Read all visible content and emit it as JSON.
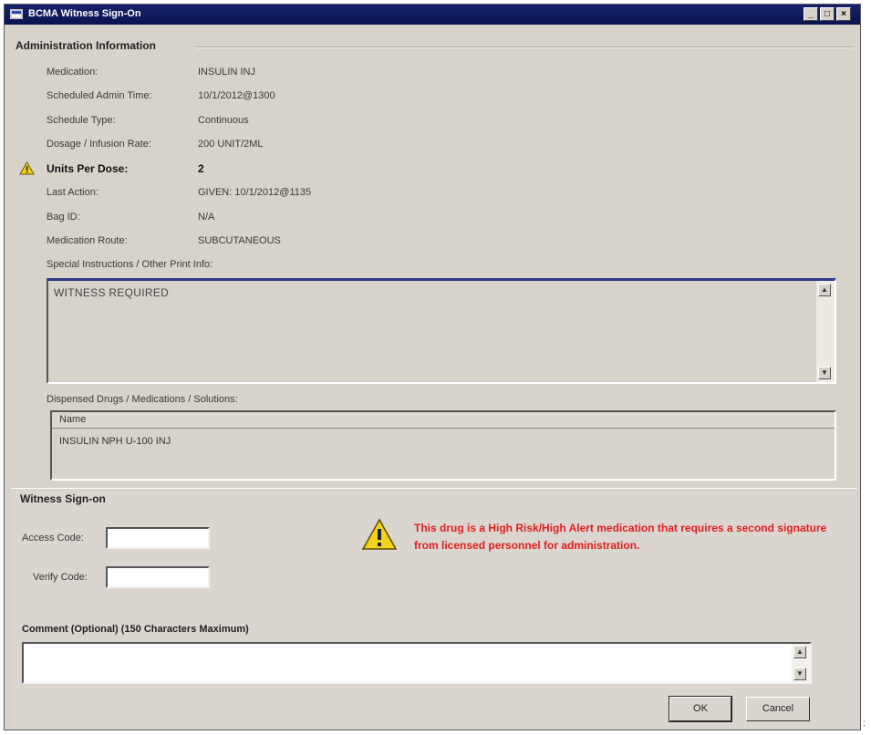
{
  "window": {
    "title": "BCMA Witness Sign-On",
    "controls": {
      "minimize": "_",
      "maximize": "□",
      "close": "×"
    }
  },
  "admin": {
    "group_title": "Administration Information",
    "fields": [
      {
        "label": "Medication:",
        "value": "INSULIN INJ"
      },
      {
        "label": "Scheduled Admin Time:",
        "value": "10/1/2012@1300"
      },
      {
        "label": "Schedule Type:",
        "value": "Continuous"
      },
      {
        "label": "Dosage / Infusion Rate:",
        "value": "200 UNIT/2ML"
      },
      {
        "label": "Units Per Dose:",
        "value": "2"
      },
      {
        "label": "Last Action:",
        "value": "GIVEN: 10/1/2012@1135"
      },
      {
        "label": "Bag ID:",
        "value": "N/A"
      },
      {
        "label": "Medication Route:",
        "value": "SUBCUTANEOUS"
      }
    ],
    "special_instructions_label": "Special Instructions / Other Print Info:",
    "special_instructions_text": "WITNESS REQUIRED",
    "dispensed_label": "Dispensed Drugs / Medications / Solutions:",
    "dispensed_columns": [
      "Name"
    ],
    "dispensed_rows": [
      "INSULIN NPH U-100 INJ"
    ]
  },
  "witness": {
    "group_title": "Witness Sign-on",
    "access_code_label": "Access Code:",
    "access_code_value": "",
    "verify_code_label": "Verify Code:",
    "verify_code_value": "",
    "alert_text": "This drug is a High Risk/High Alert medication that requires a second signature from licensed personnel for administration.",
    "comment_label": "Comment (Optional)  (150 Characters Maximum)",
    "comment_value": ""
  },
  "buttons": {
    "ok": "OK",
    "cancel": "Cancel"
  },
  "colors": {
    "title_bar": "#0e1a5c",
    "alert_red": "#e11d1d",
    "warning_yellow": "#f2d21b",
    "window_bg": "#d7d3cb"
  },
  "icons": {
    "warning": "warning-triangle-icon",
    "app": "app-icon"
  },
  "edge_mark": ":"
}
